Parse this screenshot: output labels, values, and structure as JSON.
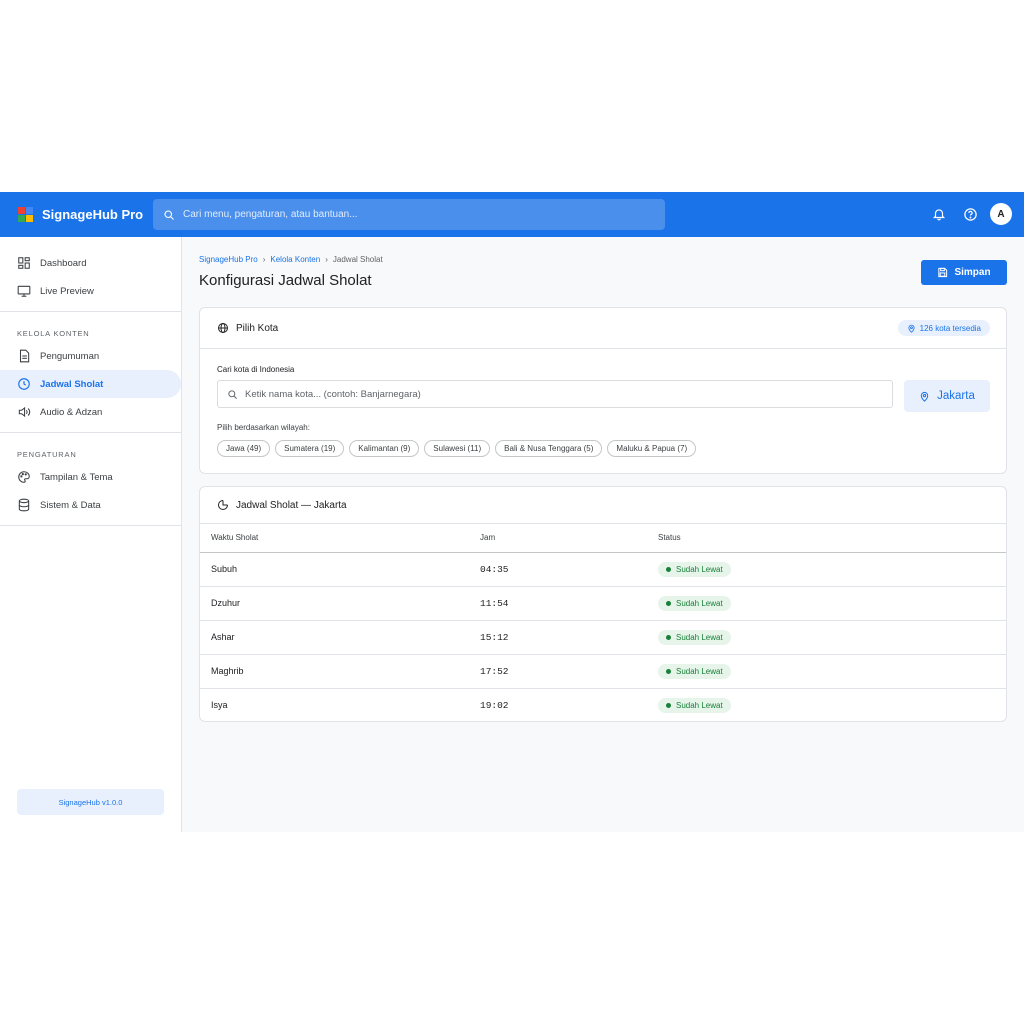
{
  "app": {
    "name": "SignageHub Pro",
    "search_placeholder": "Cari menu, pengaturan, atau bantuan...",
    "avatar_initial": "A",
    "logo_colors": [
      "#ea4335",
      "#4285f4",
      "#34a853",
      "#fbbc04"
    ]
  },
  "sidebar": {
    "top_items": [
      {
        "label": "Dashboard",
        "icon": "dashboard-icon"
      },
      {
        "label": "Live Preview",
        "icon": "monitor-icon"
      }
    ],
    "sections": [
      {
        "title": "KELOLA KONTEN",
        "items": [
          {
            "label": "Pengumuman",
            "icon": "document-icon"
          },
          {
            "label": "Jadwal Sholat",
            "icon": "clock-icon",
            "active": true
          },
          {
            "label": "Audio & Adzan",
            "icon": "speaker-icon"
          }
        ]
      },
      {
        "title": "PENGATURAN",
        "items": [
          {
            "label": "Tampilan & Tema",
            "icon": "palette-icon"
          },
          {
            "label": "Sistem & Data",
            "icon": "database-icon"
          }
        ]
      }
    ],
    "version": "SignageHub v1.0.0"
  },
  "breadcrumb": {
    "items": [
      "SignageHub Pro",
      "Kelola Konten",
      "Jadwal Sholat"
    ]
  },
  "page": {
    "title": "Konfigurasi Jadwal Sholat",
    "save_label": "Simpan"
  },
  "city_card": {
    "title": "Pilih Kota",
    "badge": "126 kota tersedia",
    "search_label": "Cari kota di Indonesia",
    "search_placeholder": "Ketik nama kota... (contoh: Banjarnegara)",
    "selected_city": "Jakarta",
    "region_label": "Pilih berdasarkan wilayah:",
    "regions": [
      "Jawa (49)",
      "Sumatera (19)",
      "Kalimantan (9)",
      "Sulawesi (11)",
      "Bali & Nusa Tenggara (5)",
      "Maluku & Papua (7)"
    ]
  },
  "schedule_card": {
    "title": "Jadwal Sholat — Jakarta",
    "columns": [
      "Waktu Sholat",
      "Jam",
      "Status"
    ],
    "rows": [
      {
        "name": "Subuh",
        "time": "04:35",
        "status": "Sudah Lewat"
      },
      {
        "name": "Dzuhur",
        "time": "11:54",
        "status": "Sudah Lewat"
      },
      {
        "name": "Ashar",
        "time": "15:12",
        "status": "Sudah Lewat"
      },
      {
        "name": "Maghrib",
        "time": "17:52",
        "status": "Sudah Lewat"
      },
      {
        "name": "Isya",
        "time": "19:02",
        "status": "Sudah Lewat"
      }
    ],
    "status_color": "#188038"
  },
  "colors": {
    "primary": "#1a73e8",
    "primary_light": "#e8f0fe",
    "success_bg": "#e6f4ea"
  }
}
